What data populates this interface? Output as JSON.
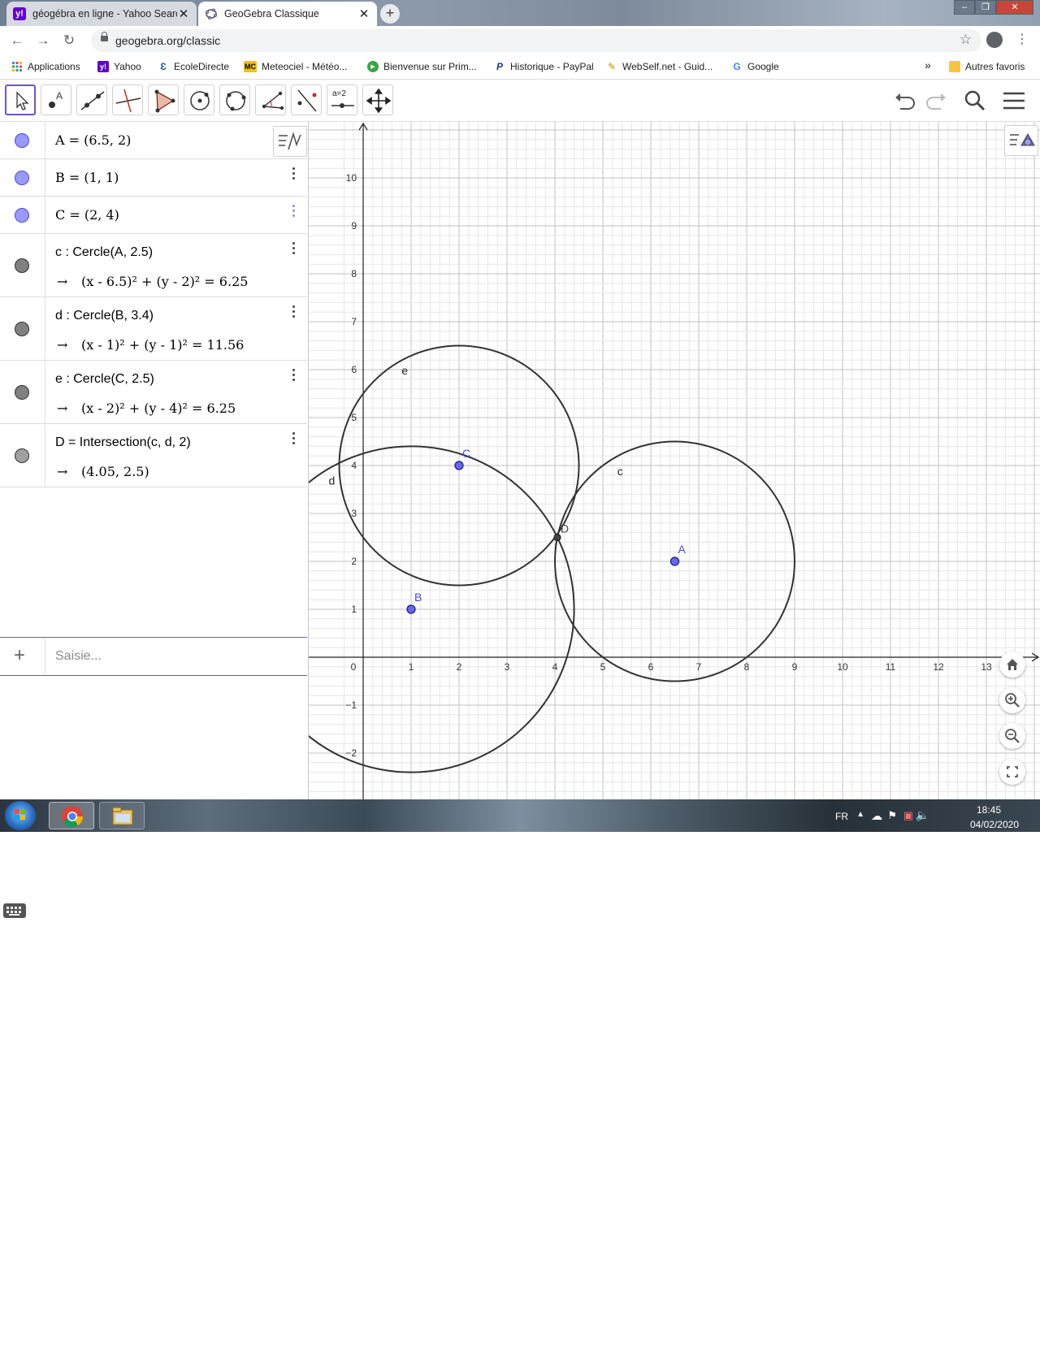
{
  "browser": {
    "tabs": [
      {
        "title": "géogébra en ligne - Yahoo Searc",
        "icon": "yahoo-icon",
        "active": false
      },
      {
        "title": "GeoGebra Classique",
        "icon": "geogebra-icon",
        "active": true
      }
    ],
    "new_tab_label": "+",
    "url": "geogebra.org/classic",
    "bookmarks": [
      {
        "label": "Applications",
        "icon": "apps-grid-icon"
      },
      {
        "label": "Yahoo",
        "icon": "yahoo-icon"
      },
      {
        "label": "EcoleDirecte",
        "icon": "ecoledirecte-icon"
      },
      {
        "label": "Meteociel - Météo...",
        "icon": "meteociel-icon"
      },
      {
        "label": "Bienvenue sur Prim...",
        "icon": "play-icon"
      },
      {
        "label": "Historique - PayPal",
        "icon": "paypal-icon"
      },
      {
        "label": "WebSelf.net - Guid...",
        "icon": "webself-icon"
      },
      {
        "label": "Google",
        "icon": "google-icon"
      }
    ],
    "bookmarks_more": "»",
    "other_bookmarks": "Autres favoris"
  },
  "toolbar": {
    "tools": [
      "move-tool",
      "point-tool",
      "line-tool",
      "perpendicular-tool",
      "polygon-tool",
      "circle-center-point-tool",
      "circle-three-points-tool",
      "angle-tool",
      "reflect-tool",
      "slider-tool",
      "move-graphics-tool"
    ],
    "slider_label": "a=2"
  },
  "algebra": {
    "rows": [
      {
        "definition": "A = (6.5, 2)",
        "value": "",
        "color": "#9999ff"
      },
      {
        "definition": "B = (1, 1)",
        "value": "",
        "color": "#9999ff"
      },
      {
        "definition": "C = (2, 4)",
        "value": "",
        "color": "#9999ff"
      },
      {
        "definition": "c : Cercle(A, 2.5)",
        "value": "(x - 6.5)² + (y - 2)² = 6.25",
        "color": "#808080"
      },
      {
        "definition": "d : Cercle(B, 3.4)",
        "value": "(x - 1)² + (y - 1)² = 11.56",
        "color": "#808080"
      },
      {
        "definition": "e : Cercle(C, 2.5)",
        "value": "(x - 2)² + (y - 4)² = 6.25",
        "color": "#808080"
      },
      {
        "definition": "D = Intersection(c, d, 2)",
        "value": "(4.05, 2.5)",
        "color": "#a0a0a0"
      }
    ],
    "arrow": "→",
    "input_placeholder": "Saisie...",
    "add_label": "+"
  },
  "graphics": {
    "x_ticks": [
      "0",
      "1",
      "2",
      "3",
      "4",
      "5",
      "6",
      "7",
      "8",
      "9",
      "10",
      "11",
      "12",
      "13"
    ],
    "y_ticks": [
      "10",
      "9",
      "8",
      "7",
      "6",
      "5",
      "4",
      "3",
      "2",
      "1",
      "−1",
      "−2"
    ],
    "points": [
      {
        "name": "A",
        "x": 6.5,
        "y": 2,
        "color": "#4b4bdc"
      },
      {
        "name": "B",
        "x": 1,
        "y": 1,
        "color": "#4b4bdc"
      },
      {
        "name": "C",
        "x": 2,
        "y": 4,
        "color": "#4b4bdc"
      },
      {
        "name": "D",
        "x": 4.05,
        "y": 2.5,
        "color": "#444444"
      }
    ],
    "circles": [
      {
        "name": "c",
        "cx": 6.5,
        "cy": 2,
        "r": 2.5
      },
      {
        "name": "d",
        "cx": 1,
        "cy": 1,
        "r": 3.4
      },
      {
        "name": "e",
        "cx": 2,
        "cy": 4,
        "r": 2.5
      }
    ]
  },
  "taskbar": {
    "lang": "FR",
    "time": "18:45",
    "date": "04/02/2020"
  }
}
